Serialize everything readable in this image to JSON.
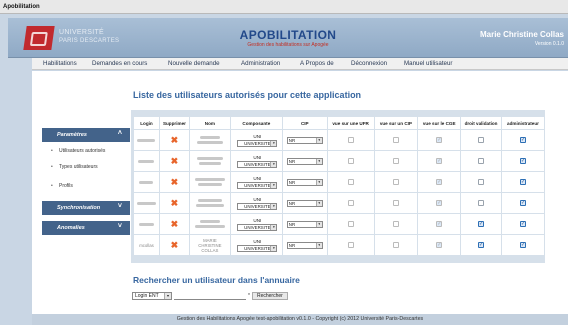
{
  "window": {
    "title": "Apobilitation"
  },
  "banner": {
    "logo_text_1": "UNIVERSITÉ",
    "logo_text_2": "PARIS DESCARTES",
    "app_title": "APOBILITATION",
    "app_subtitle": "Gestion des habilitations sur Apogée",
    "user_name": "Marie Christine Collas",
    "version": "Version 0.1.0"
  },
  "nav": [
    "Habilitations",
    "Demandes en cours",
    "Nouvelle demande",
    "Administration",
    "A Propos de",
    "Déconnexion",
    "Manuel utilisateur"
  ],
  "page": {
    "title": "Liste des utilisateurs autorisés pour cette application"
  },
  "sidebar": {
    "sections": [
      {
        "label": "Paramètres",
        "chevron": "up",
        "items": [
          "Utilisateurs autorisés",
          "Types utilisateurs",
          "Profils"
        ]
      },
      {
        "label": "Synchronisation",
        "chevron": "down",
        "items": []
      },
      {
        "label": "Anomalies",
        "chevron": "down",
        "items": []
      }
    ]
  },
  "table": {
    "headers": [
      "Login",
      "Supprimer",
      "Nom",
      "Composante",
      "CIP",
      "vue sur une UFR",
      "vue sur un CIP",
      "vue sur le CGE",
      "droit validation",
      "administrateur"
    ],
    "composante_label": "UNI",
    "composante_value": "UNIVERSITE",
    "cip_value": "NR",
    "rows": [
      {
        "login": "",
        "nom": "",
        "ufr": false,
        "cip": false,
        "cge": true,
        "validation": false,
        "admin": true
      },
      {
        "login": "",
        "nom": "",
        "ufr": false,
        "cip": false,
        "cge": true,
        "validation": false,
        "admin": true
      },
      {
        "login": "",
        "nom": "",
        "ufr": false,
        "cip": false,
        "cge": true,
        "validation": false,
        "admin": true
      },
      {
        "login": "",
        "nom": "",
        "ufr": false,
        "cip": false,
        "cge": true,
        "validation": false,
        "admin": true
      },
      {
        "login": "",
        "nom": "",
        "ufr": false,
        "cip": false,
        "cge": true,
        "validation": true,
        "admin": true
      },
      {
        "login": "mcollas",
        "nom": "MARIE CHRISTINE COLLAS",
        "ufr": false,
        "cip": false,
        "cge": true,
        "validation": true,
        "admin": true
      }
    ]
  },
  "search": {
    "title": "Rechercher un utilisateur dans l'annuaire",
    "field_option": "Login ENT",
    "required_mark": "*",
    "button": "Rechercher"
  },
  "footer": {
    "text": "Gestion des Habilitations Apogée test-apobilitation v0.1.0 - Copyright (c) 2012 Université Paris-Descartes"
  },
  "colors": {
    "banner": "#9fb6cf",
    "accent": "#3867a0",
    "delete": "#e8652b",
    "sidebar_header": "#43638a"
  }
}
